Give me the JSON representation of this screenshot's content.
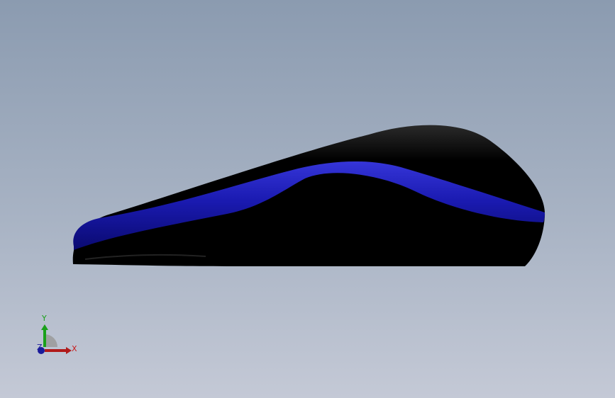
{
  "viewport": {
    "background_top": "#8b9bb0",
    "background_bottom": "#c4c9d6"
  },
  "model": {
    "body_color": "#000000",
    "stripe_color": "#1a1ab0"
  },
  "triad": {
    "x_label": "X",
    "y_label": "Y",
    "z_label": "Z",
    "x_color": "#c81a1a",
    "y_color": "#1aa01a",
    "z_color": "#1a1a9a"
  }
}
